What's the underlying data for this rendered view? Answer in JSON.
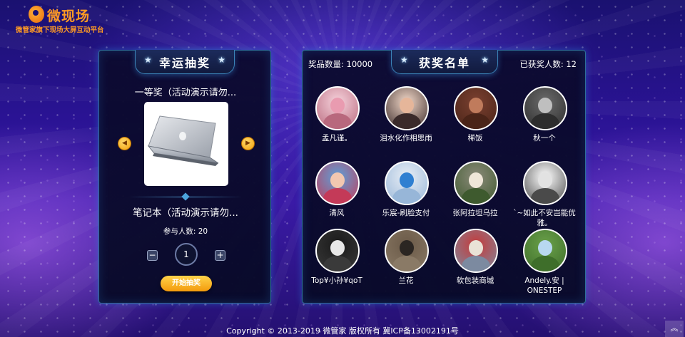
{
  "brand": {
    "title": "微现场",
    "subtitle": "微管家旗下现场大屏互动平台"
  },
  "lottery": {
    "title": "幸运抽奖",
    "prize_level": "一等奖（活动演示请勿...",
    "prize_name": "笔记本（活动演示请勿...",
    "participants_label": "参与人数: 20",
    "quantity": "1",
    "minus_label": "−",
    "plus_label": "+",
    "start_button": "开始抽奖",
    "prev_icon": "chevron-left-icon",
    "next_icon": "chevron-right-icon"
  },
  "winners_panel": {
    "title": "获奖名单",
    "prize_count_label": "奖品数量: 10000",
    "winners_count_label": "已获奖人数: 12",
    "winners": [
      {
        "name": "孟凡谨。"
      },
      {
        "name": "泪水化作相思雨"
      },
      {
        "name": "稀饭"
      },
      {
        "name": "秋一个"
      },
      {
        "name": "清风"
      },
      {
        "name": "乐宸-刷脸支付"
      },
      {
        "name": "张阿拉坦乌拉"
      },
      {
        "name": "`~如此不安岂能优雅。"
      },
      {
        "name": "Top¥小孙¥qoT"
      },
      {
        "name": "兰花"
      },
      {
        "name": "软包装商城"
      },
      {
        "name": "Andely.安 | ONESTEP"
      }
    ]
  },
  "footer": {
    "copyright": "Copyright © 2013-2019 微管家 版权所有 冀ICP备13002191号",
    "back_to_top_icon": "double-chevron-up-icon"
  }
}
